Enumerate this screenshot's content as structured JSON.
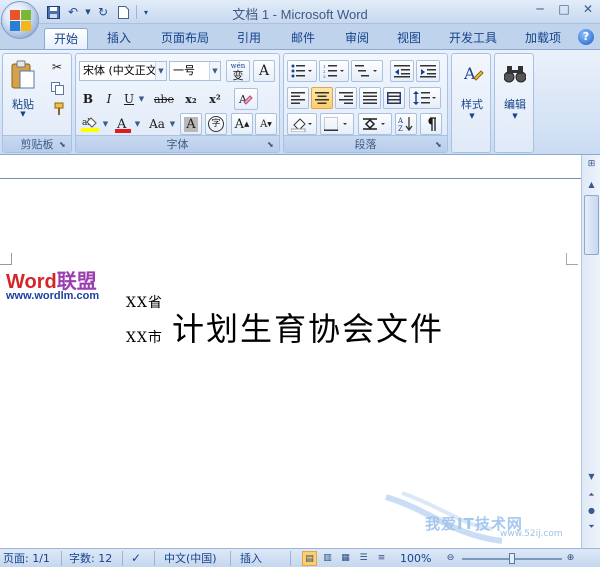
{
  "window": {
    "title": "文档 1 - Microsoft Word"
  },
  "qat": {
    "save_icon": "save-icon",
    "undo_icon": "undo-icon",
    "redo_icon": "redo-icon",
    "new_icon": "new-doc-icon"
  },
  "tabs": [
    {
      "label": "开始",
      "active": true
    },
    {
      "label": "插入"
    },
    {
      "label": "页面布局"
    },
    {
      "label": "引用"
    },
    {
      "label": "邮件"
    },
    {
      "label": "审阅"
    },
    {
      "label": "视图"
    },
    {
      "label": "开发工具"
    },
    {
      "label": "加载项"
    }
  ],
  "ribbon": {
    "clipboard": {
      "label": "剪贴板",
      "paste_label": "粘贴"
    },
    "font": {
      "label": "字体",
      "font_name": "宋体 (中文正文)",
      "font_size": "一号",
      "wen_label": "wén",
      "wen_char": "变",
      "bold": "B",
      "italic": "I",
      "underline": "U",
      "strike": "abe",
      "subscript": "x₂",
      "superscript": "x²",
      "grow": "A",
      "shrink": "A",
      "case": "Aa",
      "char_a": "A",
      "circle_char": "字"
    },
    "paragraph": {
      "label": "段落"
    },
    "styles": {
      "label": "样式"
    },
    "editing": {
      "label": "编辑"
    }
  },
  "document": {
    "line1": "XX省",
    "line2": "XX市",
    "title": "计划生育协会文件"
  },
  "watermark": {
    "logo_word": "Word",
    "logo_cn": "联盟",
    "url": "www.wordlm.com",
    "bottom_text": "我爱IT技术网",
    "bottom_url": "www.52ij.com"
  },
  "status": {
    "page": "页面: 1/1",
    "words": "字数: 12",
    "language": "中文(中国)",
    "mode": "插入",
    "zoom": "100%"
  },
  "colors": {
    "accent": "#15428b",
    "ribbon_bg": "#d5e3f5",
    "highlight": "#fbcf6b"
  }
}
